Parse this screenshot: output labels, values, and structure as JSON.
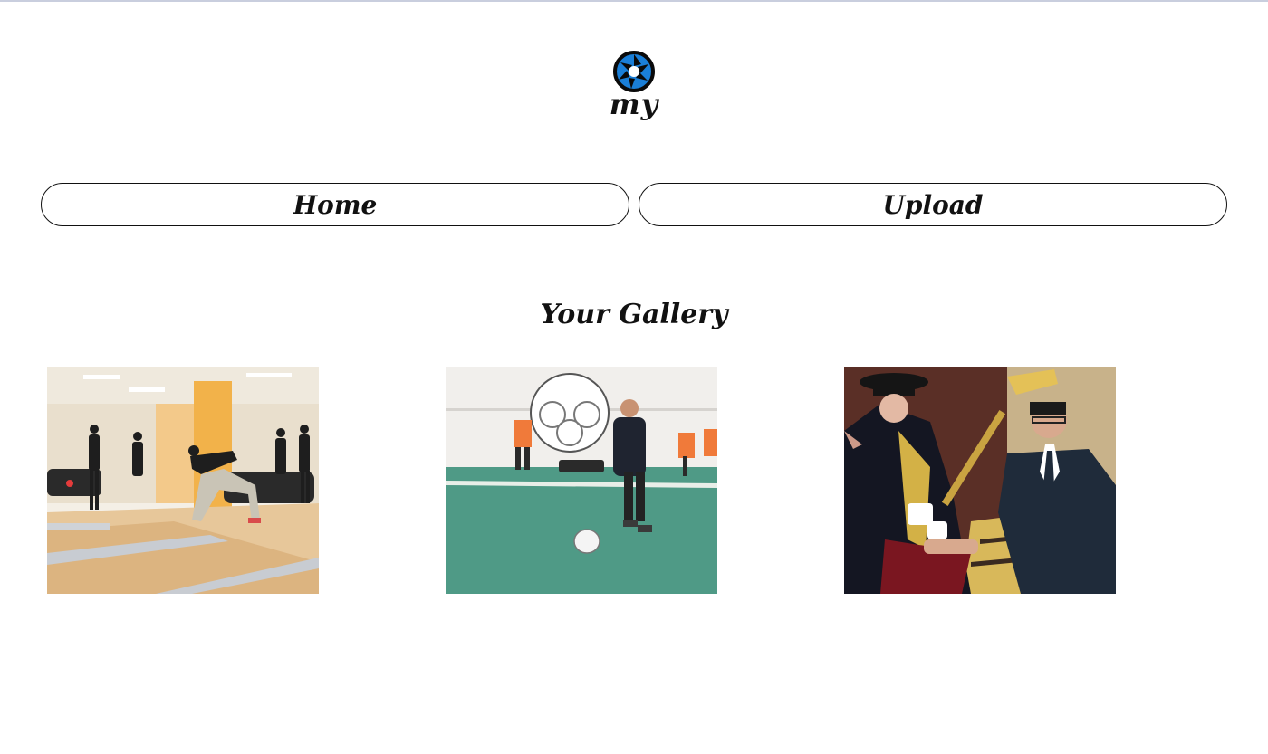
{
  "brand": {
    "logo_icon": "camera-aperture-icon",
    "name": "my",
    "accent_color": "#1a7fd8"
  },
  "nav": {
    "home_label": "Home",
    "upload_label": "Upload"
  },
  "gallery": {
    "title": "Your Gallery",
    "photos": [
      {
        "subject": "bowling"
      },
      {
        "subject": "soccer"
      },
      {
        "subject": "graduation"
      }
    ]
  }
}
